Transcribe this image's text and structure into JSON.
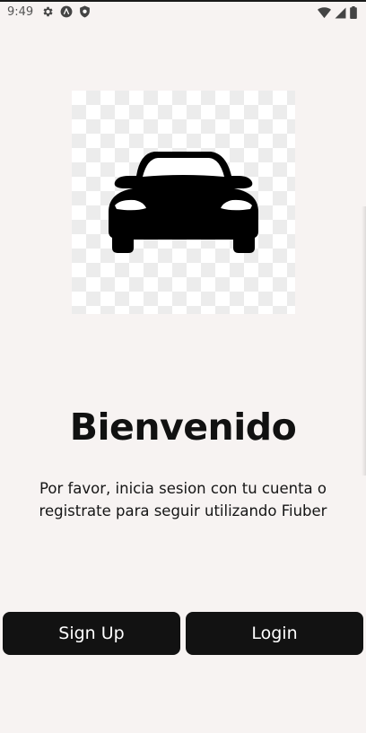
{
  "status_bar": {
    "time": "9:49",
    "left_icons": [
      "settings-icon",
      "accessibility-icon",
      "shield-icon"
    ],
    "right_icons": [
      "wifi-icon",
      "signal-icon",
      "battery-icon"
    ]
  },
  "logo": {
    "icon": "car-icon",
    "background": "transparency-checkerboard"
  },
  "welcome": {
    "title": "Bienvenido",
    "message": "Por favor, inicia sesion con tu cuenta o registrate para seguir utilizando Fiuber"
  },
  "actions": {
    "signup_label": "Sign Up",
    "login_label": "Login"
  },
  "colors": {
    "background": "#f7f3f2",
    "button": "#121212",
    "button_text": "#ffffff",
    "text": "#111111"
  }
}
